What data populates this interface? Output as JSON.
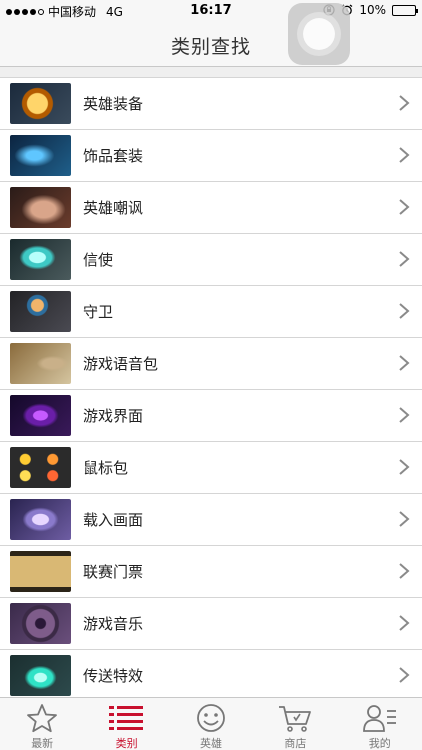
{
  "status_bar": {
    "carrier": "中国移动",
    "network": "4G",
    "time": "16:17",
    "battery_percent": "10%",
    "battery_level": 0.1,
    "battery_color": "#d0021b"
  },
  "nav": {
    "title": "类别查找"
  },
  "categories": [
    {
      "label": "英雄装备",
      "thumb_icon": "hero-equipment-thumbnail"
    },
    {
      "label": "饰品套装",
      "thumb_icon": "cosmetic-set-thumbnail"
    },
    {
      "label": "英雄嘲讽",
      "thumb_icon": "hero-taunt-thumbnail"
    },
    {
      "label": "信使",
      "thumb_icon": "courier-thumbnail"
    },
    {
      "label": "守卫",
      "thumb_icon": "ward-thumbnail"
    },
    {
      "label": "游戏语音包",
      "thumb_icon": "announcer-pack-thumbnail"
    },
    {
      "label": "游戏界面",
      "thumb_icon": "hud-skin-thumbnail"
    },
    {
      "label": "鼠标包",
      "thumb_icon": "cursor-pack-thumbnail"
    },
    {
      "label": "载入画面",
      "thumb_icon": "loading-screen-thumbnail"
    },
    {
      "label": "联赛门票",
      "thumb_icon": "league-ticket-thumbnail"
    },
    {
      "label": "游戏音乐",
      "thumb_icon": "music-pack-thumbnail"
    },
    {
      "label": "传送特效",
      "thumb_icon": "teleport-effect-thumbnail"
    }
  ],
  "tabs": [
    {
      "label": "最新",
      "icon": "star-icon",
      "active": false
    },
    {
      "label": "类别",
      "icon": "list-icon",
      "active": true
    },
    {
      "label": "英雄",
      "icon": "smiley-face-icon",
      "active": false
    },
    {
      "label": "商店",
      "icon": "shopping-cart-icon",
      "active": false
    },
    {
      "label": "我的",
      "icon": "user-profile-icon",
      "active": false
    }
  ],
  "colors": {
    "accent": "#c8102e",
    "chevron": "#8a8a8a",
    "tab_inactive": "#777777"
  }
}
